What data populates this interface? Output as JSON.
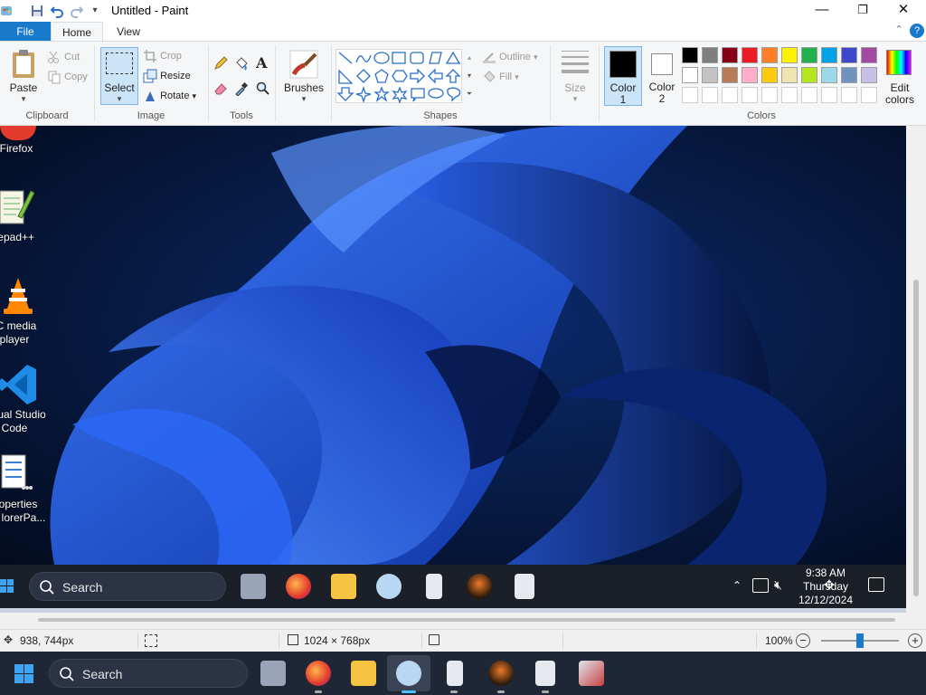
{
  "window": {
    "title": "Untitled - Paint",
    "minimize_glyph": "—",
    "maximize_glyph": "❐",
    "close_glyph": "✕"
  },
  "tabs": [
    {
      "label": "File"
    },
    {
      "label": "Home"
    },
    {
      "label": "View"
    }
  ],
  "ribbon": {
    "clipboard": {
      "label": "Clipboard",
      "paste": "Paste",
      "cut": "Cut",
      "copy": "Copy"
    },
    "image": {
      "label": "Image",
      "select": "Select",
      "crop": "Crop",
      "resize": "Resize",
      "rotate": "Rotate"
    },
    "tools": {
      "label": "Tools",
      "text_glyph": "A"
    },
    "brushes": {
      "label": "Brushes"
    },
    "shapes": {
      "label": "Shapes",
      "outline": "Outline",
      "fill": "Fill"
    },
    "size": {
      "label": "Size"
    },
    "colors": {
      "label": "Colors",
      "color1_label": "Color",
      "color1_num": "1",
      "color2_label": "Color",
      "color2_num": "2",
      "edit_colors_line1": "Edit",
      "edit_colors_line2": "colors",
      "color1_value": "#000000",
      "color2_value": "#ffffff",
      "palette_row1": [
        "#000000",
        "#7f7f7f",
        "#880015",
        "#ed1c24",
        "#ff7f27",
        "#fff200",
        "#22b14c",
        "#00a2e8",
        "#3f48cc",
        "#a349a4"
      ],
      "palette_row2": [
        "#ffffff",
        "#c3c3c3",
        "#b97a57",
        "#ffaec9",
        "#ffc90e",
        "#efe4b0",
        "#b5e61d",
        "#99d9ea",
        "#7092be",
        "#c8bfe7"
      ]
    }
  },
  "desktop_icons": [
    {
      "line1": "Firefox",
      "line2": ""
    },
    {
      "line1": "tepad++",
      "line2": ""
    },
    {
      "line1": "C media",
      "line2": "player"
    },
    {
      "line1": "ual Studio",
      "line2": "Code"
    },
    {
      "line1": "operties",
      "line2": "lorerPa..."
    }
  ],
  "inner_taskbar": {
    "search_label": "Search",
    "time": "9:38 AM",
    "day": "Thursday",
    "date": "12/12/2024"
  },
  "statusbar": {
    "cursor_pos": "938, 744px",
    "image_size": "1024 × 768px",
    "zoom": "100%",
    "zoom_level_fraction": 0.5
  },
  "taskbar": {
    "search_label": "Search"
  }
}
